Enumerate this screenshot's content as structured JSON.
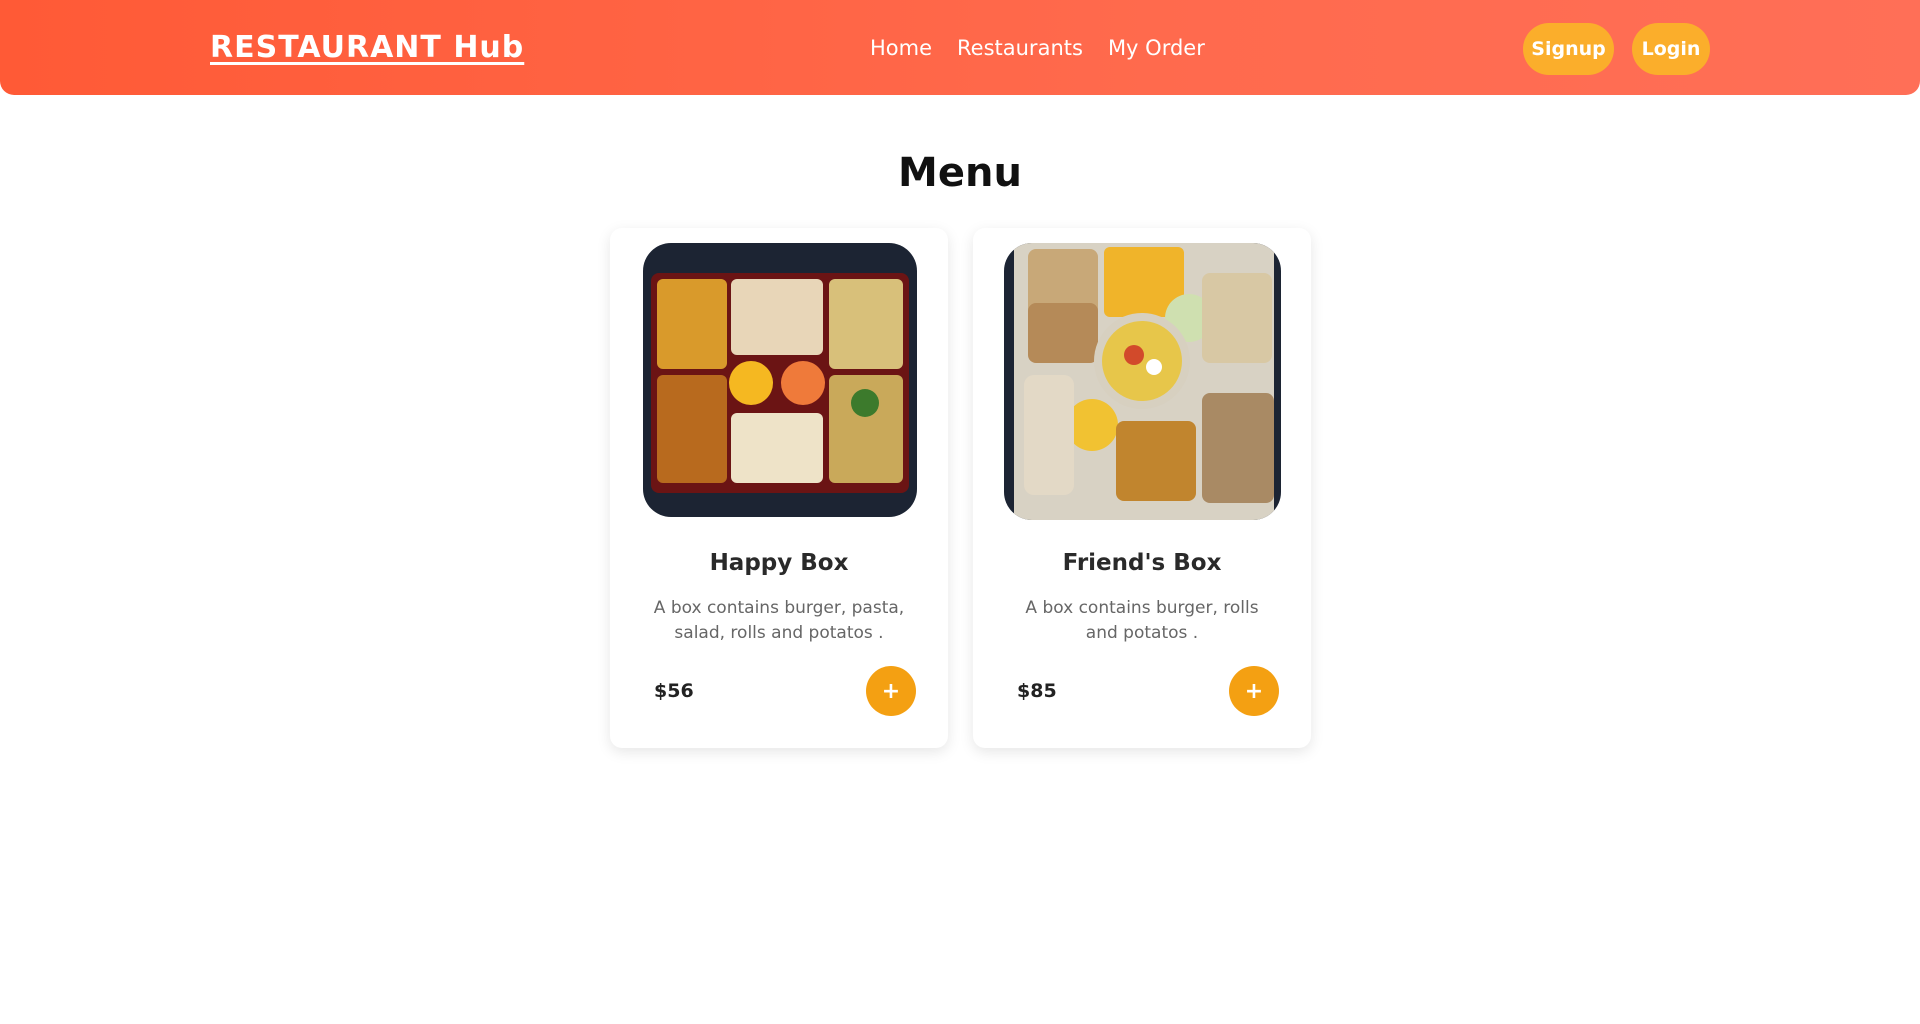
{
  "header": {
    "brand": "RESTAURANT Hub",
    "nav": [
      {
        "label": "Home"
      },
      {
        "label": "Restaurants"
      },
      {
        "label": "My Order"
      }
    ],
    "signup_label": "Signup",
    "login_label": "Login"
  },
  "main": {
    "title": "Menu",
    "items": [
      {
        "name": "Happy Box",
        "description": "A box contains burger, pasta, salad, rolls and potatos .",
        "price": "$56",
        "add_label": "+"
      },
      {
        "name": "Friend's Box",
        "description": "A box contains burger, rolls and potatos .",
        "price": "$85",
        "add_label": "+"
      }
    ]
  },
  "colors": {
    "header_gradient_start": "#ff5a36",
    "header_gradient_end": "#ff6f57",
    "pill_button": "#fbae2b",
    "add_button": "#f4a012"
  }
}
